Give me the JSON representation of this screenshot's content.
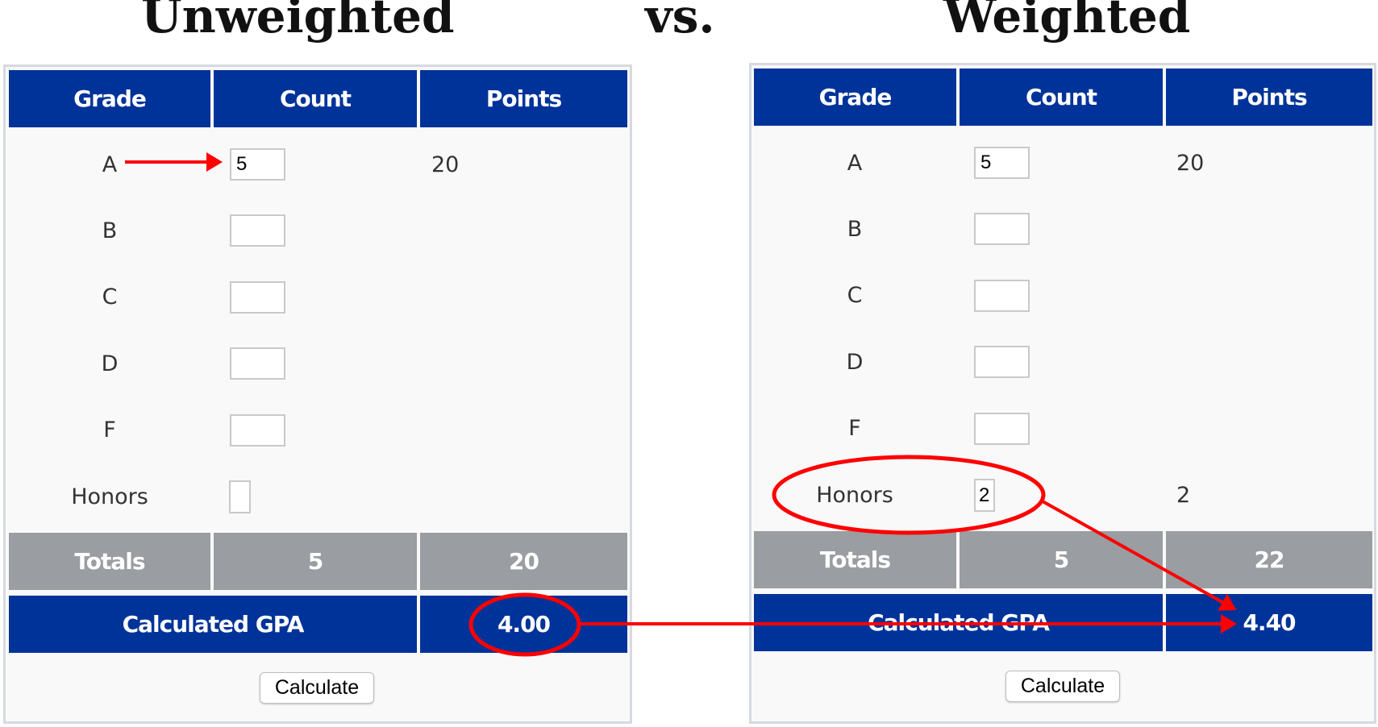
{
  "titles": {
    "left": "Unweighted",
    "middle": "vs.",
    "right": "Weighted"
  },
  "colors": {
    "header": "#003399",
    "totals": "#9a9da1",
    "annotation": "#ff0000"
  },
  "unweighted": {
    "headers": [
      "Grade",
      "Count",
      "Points"
    ],
    "rows": [
      {
        "grade": "A",
        "count": "5",
        "points": "20"
      },
      {
        "grade": "B",
        "count": "",
        "points": ""
      },
      {
        "grade": "C",
        "count": "",
        "points": ""
      },
      {
        "grade": "D",
        "count": "",
        "points": ""
      },
      {
        "grade": "F",
        "count": "",
        "points": ""
      },
      {
        "grade": "Honors",
        "count": "",
        "points": ""
      }
    ],
    "totals": {
      "label": "Totals",
      "count": "5",
      "points": "20"
    },
    "gpa": {
      "label": "Calculated GPA",
      "value": "4.00"
    },
    "button": "Calculate"
  },
  "weighted": {
    "headers": [
      "Grade",
      "Count",
      "Points"
    ],
    "rows": [
      {
        "grade": "A",
        "count": "5",
        "points": "20"
      },
      {
        "grade": "B",
        "count": "",
        "points": ""
      },
      {
        "grade": "C",
        "count": "",
        "points": ""
      },
      {
        "grade": "D",
        "count": "",
        "points": ""
      },
      {
        "grade": "F",
        "count": "",
        "points": ""
      },
      {
        "grade": "Honors",
        "count": "2",
        "points": "2"
      }
    ],
    "totals": {
      "label": "Totals",
      "count": "5",
      "points": "22"
    },
    "gpa": {
      "label": "Calculated GPA",
      "value": "4.40"
    },
    "button": "Calculate"
  }
}
